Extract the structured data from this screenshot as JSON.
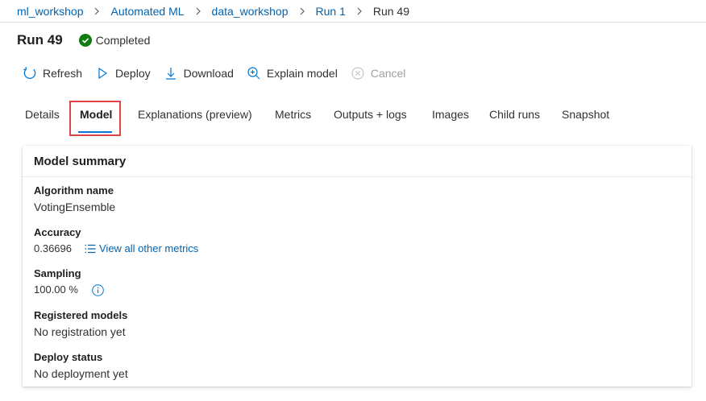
{
  "breadcrumb": {
    "items": [
      "ml_workshop",
      "Automated ML",
      "data_workshop",
      "Run 1"
    ],
    "current": "Run 49"
  },
  "header": {
    "title": "Run 49",
    "status": "Completed"
  },
  "toolbar": {
    "refresh": "Refresh",
    "deploy": "Deploy",
    "download": "Download",
    "explain": "Explain model",
    "cancel": "Cancel"
  },
  "tabs": [
    "Details",
    "Model",
    "Explanations (preview)",
    "Metrics",
    "Outputs + logs",
    "Images",
    "Child runs",
    "Snapshot"
  ],
  "active_tab": "Model",
  "summary": {
    "title": "Model summary",
    "algorithm_label": "Algorithm name",
    "algorithm_value": "VotingEnsemble",
    "accuracy_label": "Accuracy",
    "accuracy_value": "0.36696",
    "metrics_link": "View all other metrics",
    "sampling_label": "Sampling",
    "sampling_value": "100.00 %",
    "registered_label": "Registered models",
    "registered_value": "No registration yet",
    "deploy_label": "Deploy status",
    "deploy_value": "No deployment yet"
  },
  "colors": {
    "link": "#0063b1",
    "accent": "#0078d4",
    "success": "#107c10",
    "highlight": "#e04343",
    "disabled": "#a19f9d"
  },
  "icons": [
    "chevron-right-icon",
    "check-circle-icon",
    "refresh-icon",
    "play-outline-icon",
    "download-icon",
    "zoom-in-icon",
    "cancel-circle-icon",
    "list-icon",
    "info-icon"
  ]
}
